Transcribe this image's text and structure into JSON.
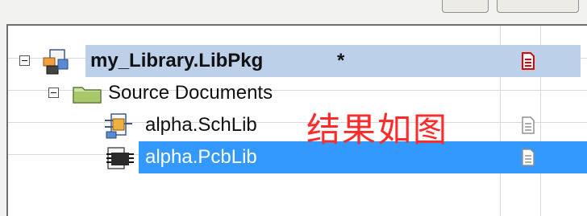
{
  "tree": {
    "project": {
      "name": "my_Library.LibPkg",
      "modified_marker": "*"
    },
    "folder": {
      "name": "Source Documents"
    },
    "files": [
      {
        "name": "alpha.SchLib"
      },
      {
        "name": "alpha.PcbLib"
      }
    ]
  },
  "annotation": "结果如图",
  "colors": {
    "selection_inactive": "#bcd0ea",
    "selection_active": "#3399ff",
    "annotation": "#ff2a2a",
    "status_modified": "#e00000"
  },
  "icons": {
    "project": "libpkg-project-icon",
    "folder": "folder-icon",
    "schlib": "schlib-document-icon",
    "pcblib": "pcblib-document-icon",
    "status_modified": "modified-document-icon",
    "status_saved": "saved-document-icon"
  }
}
